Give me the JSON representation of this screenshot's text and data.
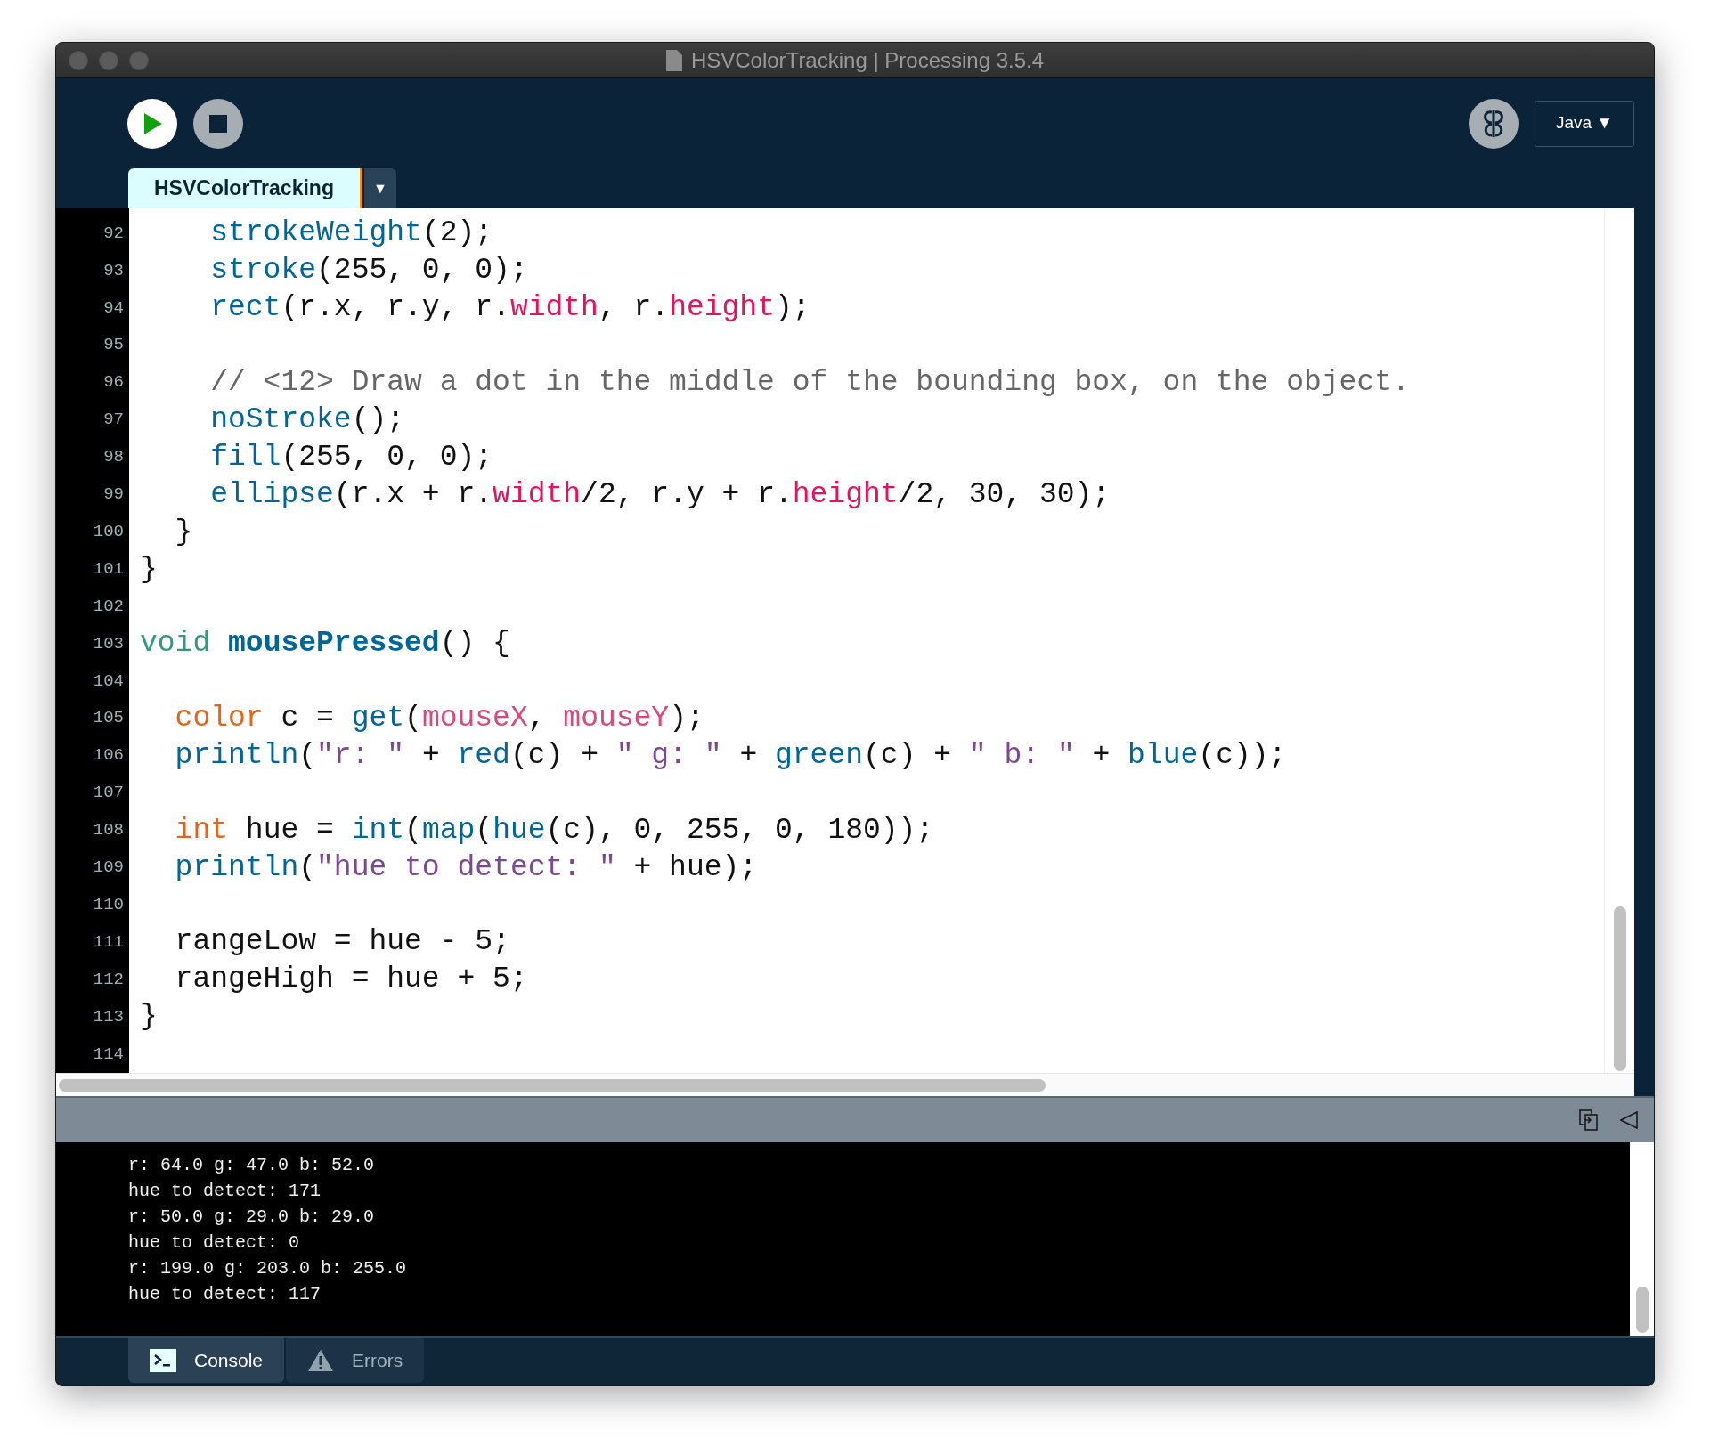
{
  "window": {
    "title": "HSVColorTracking | Processing 3.5.4"
  },
  "toolbar": {
    "mode": "Java ▼"
  },
  "editor_tabs": [
    {
      "label": "HSVColorTracking",
      "selected": true
    }
  ],
  "tab_menu": "▼",
  "code_lines": [
    {
      "number": "92",
      "tokens": [
        {
          "kind": "function",
          "text": "    strokeWeight"
        },
        {
          "kind": "plain",
          "text": "(2);"
        }
      ]
    },
    {
      "number": "93",
      "tokens": [
        {
          "kind": "function",
          "text": "    stroke"
        },
        {
          "kind": "plain",
          "text": "(255, 0, 0);"
        }
      ]
    },
    {
      "number": "94",
      "tokens": [
        {
          "kind": "function",
          "text": "    rect"
        },
        {
          "kind": "plain",
          "text": "(r.x, r.y, r."
        },
        {
          "kind": "field",
          "text": "width"
        },
        {
          "kind": "plain",
          "text": ", r."
        },
        {
          "kind": "field",
          "text": "height"
        },
        {
          "kind": "plain",
          "text": ");"
        }
      ]
    },
    {
      "number": "95"
    },
    {
      "number": "96",
      "tokens": [
        {
          "kind": "comment",
          "text": "    // <12> Draw a dot in the middle of the bounding box, on the object."
        }
      ]
    },
    {
      "number": "97",
      "tokens": [
        {
          "kind": "function",
          "text": "    noStroke"
        },
        {
          "kind": "plain",
          "text": "();"
        }
      ]
    },
    {
      "number": "98",
      "tokens": [
        {
          "kind": "function",
          "text": "    fill"
        },
        {
          "kind": "plain",
          "text": "(255, 0, 0);"
        }
      ]
    },
    {
      "number": "99",
      "tokens": [
        {
          "kind": "function",
          "text": "    ellipse"
        },
        {
          "kind": "plain",
          "text": "(r.x + r."
        },
        {
          "kind": "field",
          "text": "width"
        },
        {
          "kind": "plain",
          "text": "/2, r.y + r."
        },
        {
          "kind": "field",
          "text": "height"
        },
        {
          "kind": "plain",
          "text": "/2, 30, 30);"
        }
      ]
    },
    {
      "number": "100",
      "tokens": [
        {
          "kind": "plain",
          "text": "  }"
        }
      ]
    },
    {
      "number": "101",
      "tokens": [
        {
          "kind": "plain",
          "text": "}"
        }
      ]
    },
    {
      "number": "102"
    },
    {
      "number": "103",
      "tokens": [
        {
          "kind": "keyword",
          "text": "void"
        },
        {
          "kind": "definition",
          "text": " mousePressed"
        },
        {
          "kind": "plain",
          "text": "() {"
        }
      ]
    },
    {
      "number": "104"
    },
    {
      "number": "105",
      "tokens": [
        {
          "kind": "type",
          "text": "  color"
        },
        {
          "kind": "plain",
          "text": " c = "
        },
        {
          "kind": "function",
          "text": "get"
        },
        {
          "kind": "plain",
          "text": "("
        },
        {
          "kind": "variable",
          "text": "mouseX"
        },
        {
          "kind": "plain",
          "text": ", "
        },
        {
          "kind": "variable",
          "text": "mouseY"
        },
        {
          "kind": "plain",
          "text": ");"
        }
      ]
    },
    {
      "number": "106",
      "tokens": [
        {
          "kind": "function",
          "text": "  println"
        },
        {
          "kind": "plain",
          "text": "("
        },
        {
          "kind": "string",
          "text": "\"r: \""
        },
        {
          "kind": "plain",
          "text": " + "
        },
        {
          "kind": "function",
          "text": "red"
        },
        {
          "kind": "plain",
          "text": "(c) + "
        },
        {
          "kind": "string",
          "text": "\" g: \""
        },
        {
          "kind": "plain",
          "text": " + "
        },
        {
          "kind": "function",
          "text": "green"
        },
        {
          "kind": "plain",
          "text": "(c) + "
        },
        {
          "kind": "string",
          "text": "\" b: \""
        },
        {
          "kind": "plain",
          "text": " + "
        },
        {
          "kind": "function",
          "text": "blue"
        },
        {
          "kind": "plain",
          "text": "(c));"
        }
      ]
    },
    {
      "number": "107"
    },
    {
      "number": "108",
      "tokens": [
        {
          "kind": "type",
          "text": "  int"
        },
        {
          "kind": "plain",
          "text": " hue = "
        },
        {
          "kind": "function",
          "text": "int"
        },
        {
          "kind": "plain",
          "text": "("
        },
        {
          "kind": "function",
          "text": "map"
        },
        {
          "kind": "plain",
          "text": "("
        },
        {
          "kind": "function",
          "text": "hue"
        },
        {
          "kind": "plain",
          "text": "(c), 0, 255, 0, 180));"
        }
      ]
    },
    {
      "number": "109",
      "tokens": [
        {
          "kind": "function",
          "text": "  println"
        },
        {
          "kind": "plain",
          "text": "("
        },
        {
          "kind": "string",
          "text": "\"hue to detect: \""
        },
        {
          "kind": "plain",
          "text": " + hue);"
        }
      ]
    },
    {
      "number": "110"
    },
    {
      "number": "111",
      "tokens": [
        {
          "kind": "plain",
          "text": "  rangeLow = hue - 5;"
        }
      ]
    },
    {
      "number": "112",
      "tokens": [
        {
          "kind": "plain",
          "text": "  rangeHigh = hue + 5;"
        }
      ]
    },
    {
      "number": "113",
      "tokens": [
        {
          "kind": "plain",
          "text": "}"
        }
      ]
    },
    {
      "number": "114"
    }
  ],
  "console_lines": [
    "r: 64.0 g: 47.0 b: 52.0",
    "hue to detect: 171",
    "r: 50.0 g: 29.0 b: 29.0",
    "hue to detect: 0",
    "r: 199.0 g: 203.0 b: 255.0",
    "hue to detect: 117"
  ],
  "bottom_tabs": [
    {
      "label": "Console",
      "kind": "console",
      "selected": true
    },
    {
      "label": "Errors",
      "kind": "errors",
      "selected": false
    }
  ]
}
